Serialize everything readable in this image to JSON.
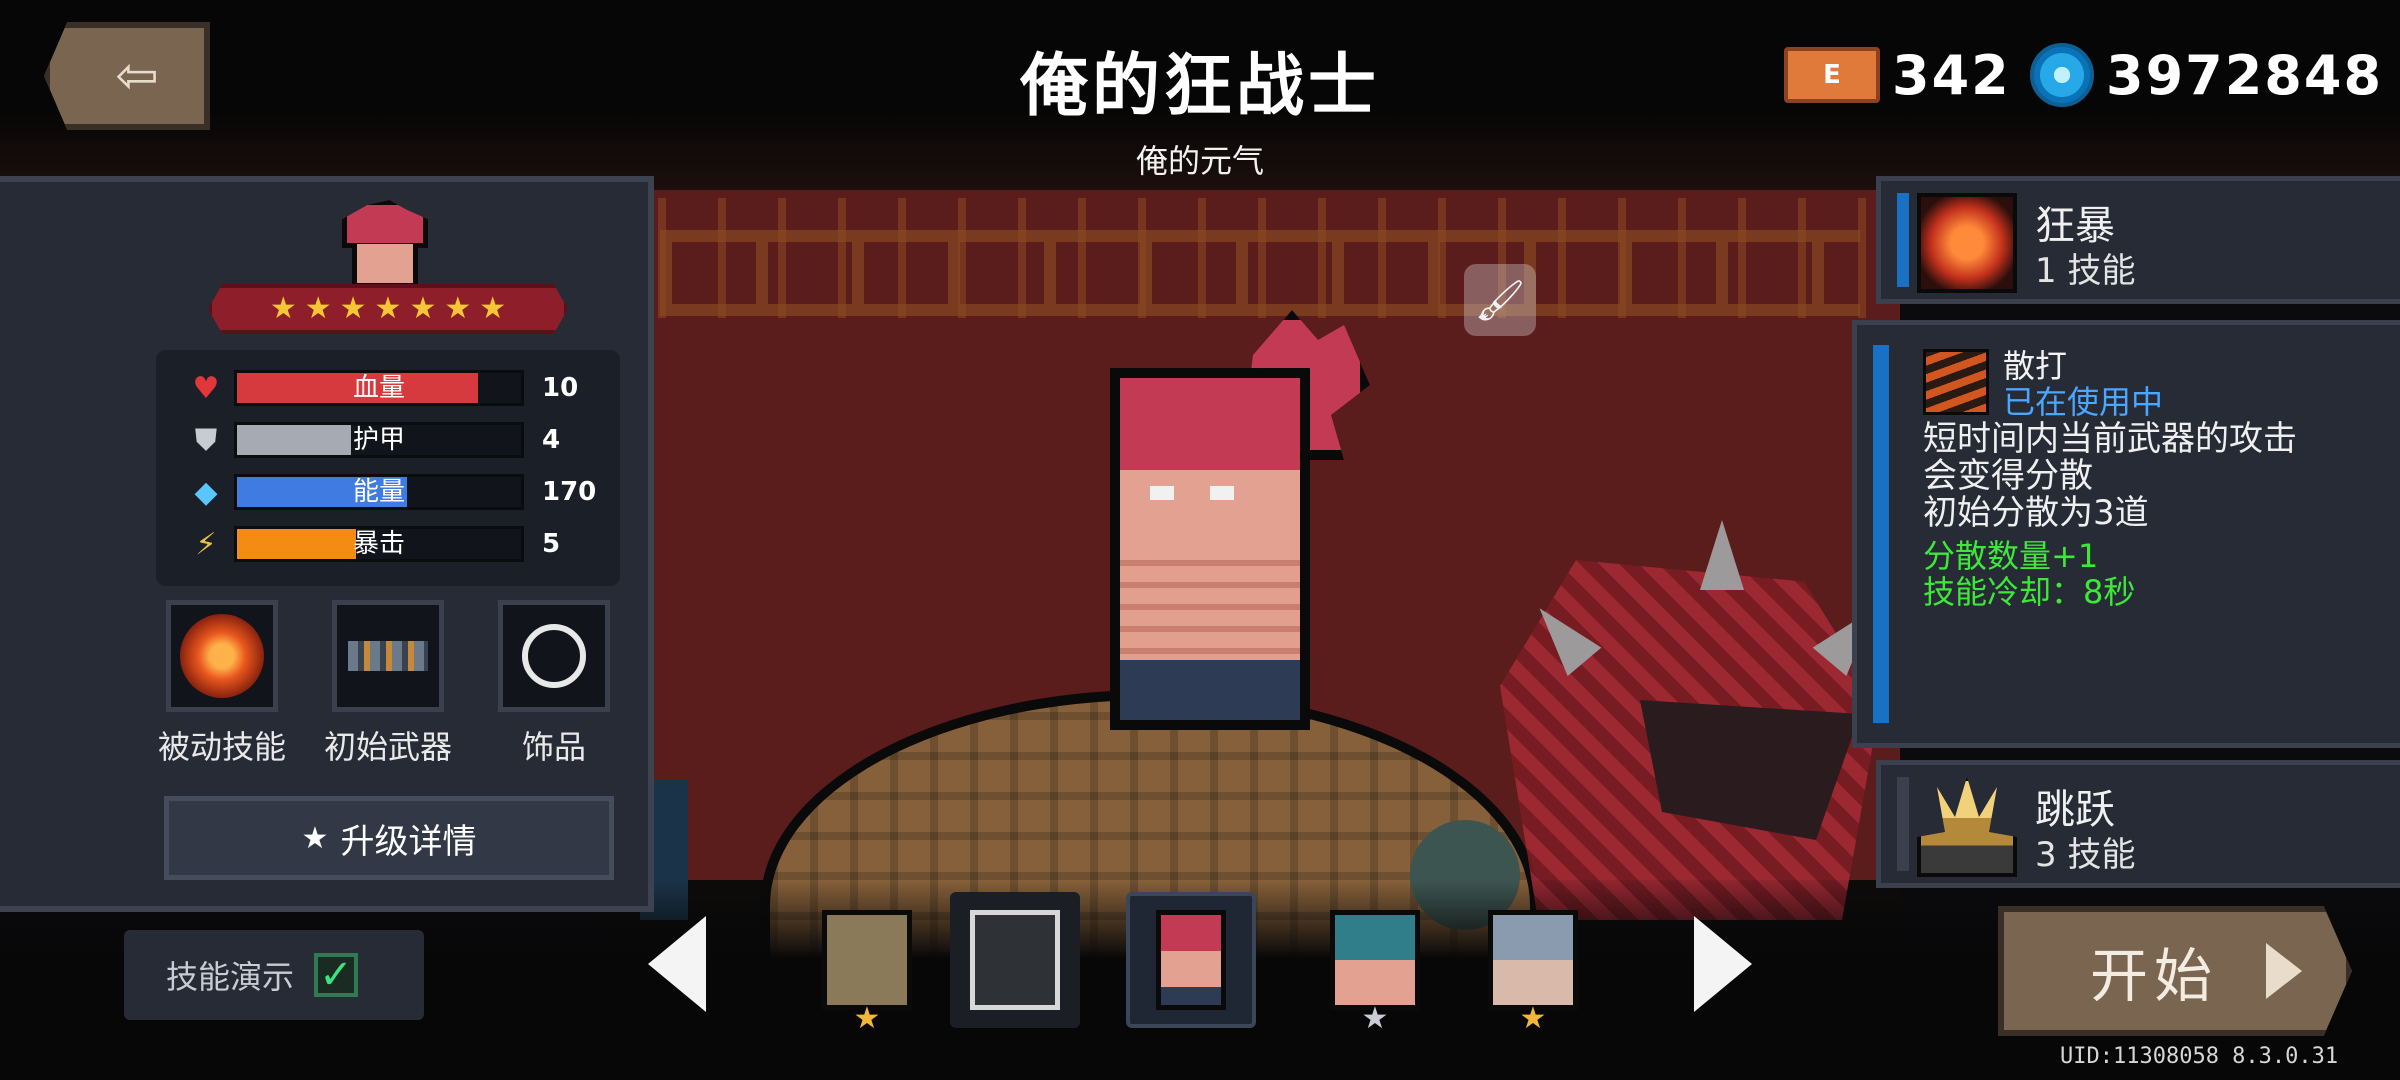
{
  "header": {
    "title": "俺的狂战士",
    "subtitle": "俺的元气",
    "exit_icon": "exit-icon",
    "currency": {
      "card_label": "E",
      "card_count": "342",
      "gems": "3972848"
    }
  },
  "hero": {
    "stars": 7,
    "stats": [
      {
        "icon": "heart-icon",
        "label": "血量",
        "value": "10",
        "fill": 0.85,
        "color": "#d63a3e"
      },
      {
        "icon": "shield-icon",
        "label": "护甲",
        "value": "4",
        "fill": 0.4,
        "color": "#a6abb3"
      },
      {
        "icon": "diamond-icon",
        "label": "能量",
        "value": "170",
        "fill": 0.6,
        "color": "#3f7be0"
      },
      {
        "icon": "crit-icon",
        "label": "暴击",
        "value": "5",
        "fill": 0.42,
        "color": "#f48b12"
      }
    ],
    "equipment": [
      {
        "label": "被动技能",
        "icon": "passive-skill-icon"
      },
      {
        "label": "初始武器",
        "icon": "starting-weapon-icon"
      },
      {
        "label": "饰品",
        "icon": "accessory-icon"
      }
    ],
    "upgrade_label": "升级详情"
  },
  "demo": {
    "label": "技能演示",
    "checked": true
  },
  "carousel": {
    "characters": [
      "golden-knight",
      "dark-weapon",
      "berserker",
      "blue-warrior",
      "hooded-assassin"
    ]
  },
  "skills": {
    "primary": {
      "name": "狂暴",
      "sub": "1 技能"
    },
    "detail": {
      "name": "散打",
      "status": "已在使用中",
      "desc": [
        "短时间内当前武器的攻击",
        "会变得分散",
        "初始分散为3道"
      ],
      "effects": [
        "分散数量+1",
        "技能冷却：8秒"
      ]
    },
    "secondary": {
      "name": "跳跃",
      "sub": "3 技能"
    }
  },
  "start": {
    "label": "开始"
  },
  "uid": "UID:11308058 8.3.0.31",
  "colors": {
    "accent_blue": "#1971c6",
    "button_brown": "#7a6550",
    "panel": "#262b35",
    "effect_green": "#3ee73a"
  }
}
